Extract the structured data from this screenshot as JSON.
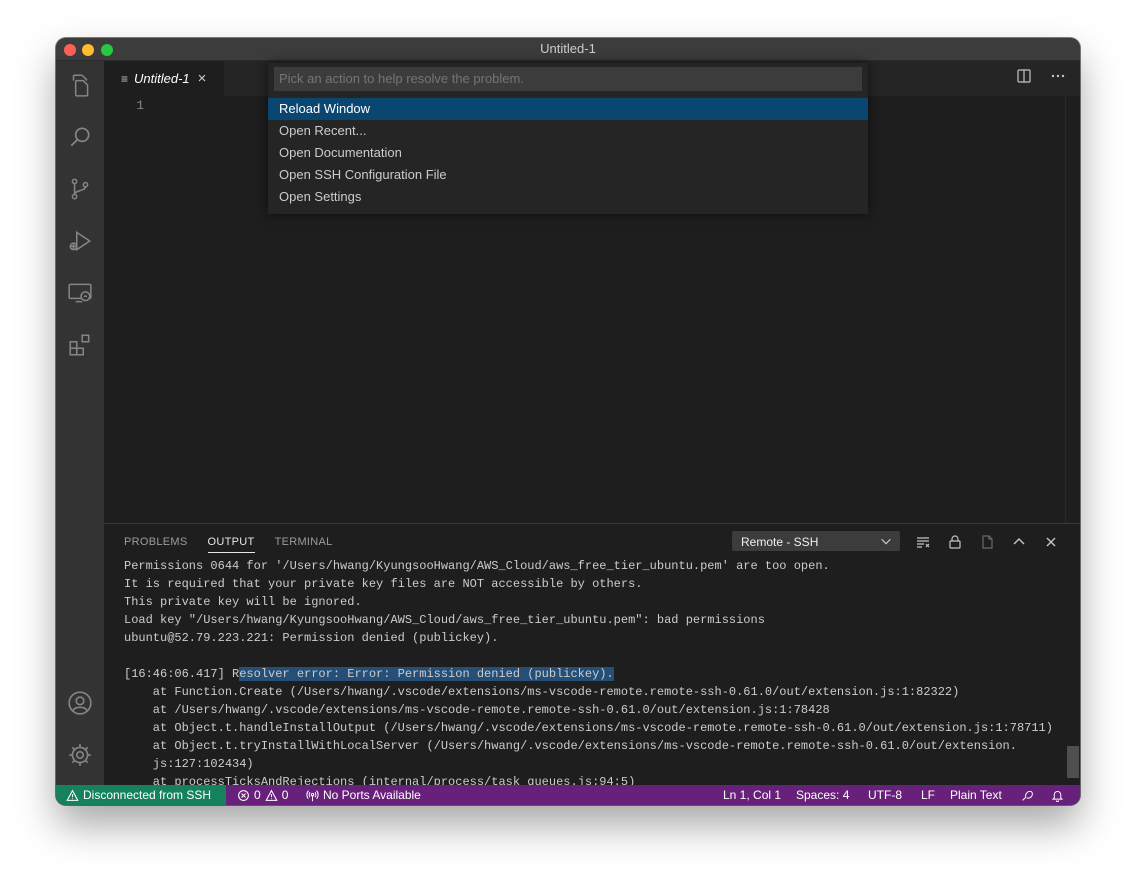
{
  "window": {
    "title": "Untitled-1"
  },
  "activity_bar": {
    "top": [
      "files-icon",
      "search-icon",
      "source-control-icon",
      "run-debug-icon",
      "remote-explorer-icon",
      "extensions-icon"
    ],
    "bottom": [
      "account-icon",
      "settings-gear-icon"
    ]
  },
  "tabs": [
    {
      "label": "Untitled-1",
      "icon": "file-lines-icon",
      "close": "×"
    }
  ],
  "tab_actions": [
    "split-editor-icon",
    "more-actions-icon"
  ],
  "editor": {
    "line_numbers": [
      "1"
    ]
  },
  "quick_pick": {
    "placeholder": "Pick an action to help resolve the problem.",
    "items": [
      "Reload Window",
      "Open Recent...",
      "Open Documentation",
      "Open SSH Configuration File",
      "Open Settings"
    ],
    "selected_index": 0
  },
  "panel": {
    "tabs": [
      "PROBLEMS",
      "OUTPUT",
      "TERMINAL"
    ],
    "active_tab": "OUTPUT",
    "channel": "Remote - SSH",
    "actions": [
      "clear-output-icon",
      "lock-scroll-icon",
      "open-log-file-icon",
      "maximize-panel-icon",
      "close-panel-icon"
    ],
    "output": {
      "l1": "Permissions 0644 for '/Users/hwang/KyungsooHwang/AWS_Cloud/aws_free_tier_ubuntu.pem' are too open.",
      "l2": "It is required that your private key files are NOT accessible by others.",
      "l3": "This private key will be ignored.",
      "l4": "Load key \"/Users/hwang/KyungsooHwang/AWS_Cloud/aws_free_tier_ubuntu.pem\": bad permissions",
      "l5": "ubuntu@52.79.223.221: Permission denied (publickey).",
      "l6": "",
      "l7_prefix": "[16:46:06.417] R",
      "l7_selected": "esolver error: Error: Permission denied (publickey).",
      "l8": "    at Function.Create (/Users/hwang/.vscode/extensions/ms-vscode-remote.remote-ssh-0.61.0/out/extension.js:1:82322)",
      "l9": "    at /Users/hwang/.vscode/extensions/ms-vscode-remote.remote-ssh-0.61.0/out/extension.js:1:78428",
      "l10": "    at Object.t.handleInstallOutput (/Users/hwang/.vscode/extensions/ms-vscode-remote.remote-ssh-0.61.0/out/extension.js:1:78711)",
      "l11": "    at Object.t.tryInstallWithLocalServer (/Users/hwang/.vscode/extensions/ms-vscode-remote.remote-ssh-0.61.0/out/extension.",
      "l12": "    js:127:102434)",
      "l13": "    at processTicksAndRejections (internal/process/task_queues.js:94:5)"
    }
  },
  "status_bar": {
    "remote": "Disconnected from SSH",
    "errors": "0",
    "warnings": "0",
    "ports": "No Ports Available",
    "position": "Ln 1, Col 1",
    "spaces": "Spaces: 4",
    "encoding": "UTF-8",
    "eol": "LF",
    "language": "Plain Text",
    "icons": [
      "feedback-icon",
      "notifications-bell-icon"
    ]
  },
  "colors": {
    "status_bar": "#68217a",
    "remote_indicator": "#16825d",
    "selection": "#264f78",
    "quick_pick_active": "#094771"
  }
}
